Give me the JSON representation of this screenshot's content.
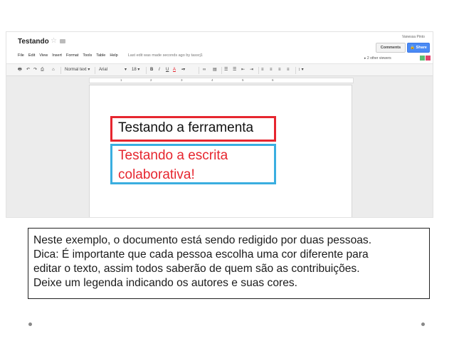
{
  "docs": {
    "title": "Testando",
    "user_name": "Vanessa Pinto",
    "comments_label": "Comments",
    "share_label": "Share",
    "viewers_label": "2 other viewers",
    "viewer_colors": [
      "#5bbf73",
      "#e0446c"
    ],
    "menu": [
      "File",
      "Edit",
      "View",
      "Insert",
      "Format",
      "Tools",
      "Table",
      "Help"
    ],
    "last_edit": "Last edit was made seconds ago by tassrj1",
    "toolbar": {
      "style": "Normal text",
      "font": "Arial",
      "size": "18"
    },
    "ruler_numbers": [
      "1",
      "2",
      "3",
      "4",
      "5",
      "6"
    ],
    "content": {
      "red_box_text": "Testando a ferramenta",
      "blue_box_text": "Testando a escrita colaborativa!",
      "red_color": "#e6262f",
      "blue_color": "#3aaee0"
    }
  },
  "caption": {
    "lines": [
      "Neste exemplo, o documento está sendo redigido por duas pessoas.",
      "Dica: É importante que cada pessoa escolha uma cor diferente para",
      "editar o texto, assim todos saberão de quem são as contribuições.",
      "Deixe um legenda indicando os autores e suas cores."
    ]
  }
}
